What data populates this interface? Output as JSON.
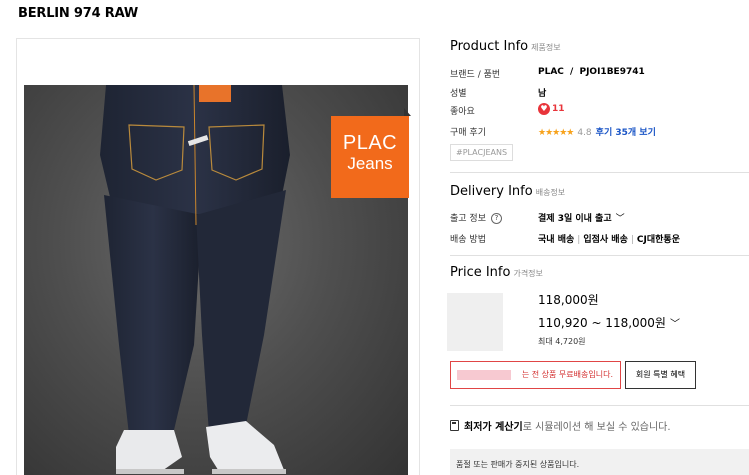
{
  "product": {
    "name": "BERLIN 974 RAW",
    "badge_line1": "PLAC",
    "badge_line2": "Jeans"
  },
  "product_info": {
    "title": "Product Info",
    "subtitle": "제품정보",
    "rows": [
      {
        "label": "브랜드 / 품번",
        "value_brand": "PLAC",
        "value_sep": "/",
        "value_code": "PJOI1BE9741"
      },
      {
        "label": "성별",
        "value": "남"
      },
      {
        "label": "좋아요",
        "value": "11"
      },
      {
        "label": "구매 후기",
        "stars": "★★★★★",
        "rating": "4.8",
        "review_link": "후기 35개 보기"
      }
    ],
    "tag": "#PLACJEANS"
  },
  "delivery_info": {
    "title": "Delivery Info",
    "subtitle": "배송정보",
    "ship_label": "출고 정보",
    "ship_value": "결제 3일 이내 출고",
    "method_label": "배송 방법",
    "method_values": [
      "국내 배송",
      "입점사 배송",
      "CJ대한통운"
    ],
    "method_sep": "|"
  },
  "price_info": {
    "title": "Price Info",
    "subtitle": "가격정보",
    "price": "118,000원",
    "price_range": "110,920 ~ 118,000원",
    "max_discount": "최대 4,720원",
    "free_shipping": "는 전 상품 무료배송입니다.",
    "member_benefit": "회원 특별 혜택"
  },
  "calculator": {
    "label": "최저가 계산기",
    "rest": "로 시뮬레이션 해 보실 수 있습니다."
  },
  "notice": "품절 또는 판매가 중지된 상품입니다.",
  "colors": {
    "accent_orange": "#f26a1b",
    "like_red": "#e8343a",
    "link_blue": "#1a55c6",
    "alert_red": "#d32e2e"
  },
  "icons": {
    "heart": "heart-icon",
    "info": "info-circle-icon",
    "chevron": "chevron-down-icon",
    "calculator": "calculator-icon"
  }
}
